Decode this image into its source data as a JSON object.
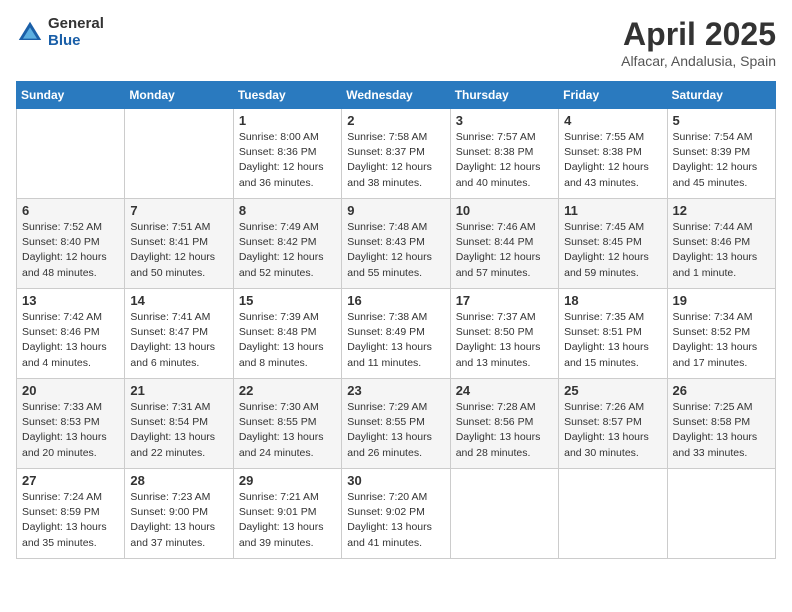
{
  "header": {
    "logo_general": "General",
    "logo_blue": "Blue",
    "month_title": "April 2025",
    "location": "Alfacar, Andalusia, Spain"
  },
  "weekdays": [
    "Sunday",
    "Monday",
    "Tuesday",
    "Wednesday",
    "Thursday",
    "Friday",
    "Saturday"
  ],
  "weeks": [
    [
      null,
      null,
      {
        "day": 1,
        "sunrise": "8:00 AM",
        "sunset": "8:36 PM",
        "daylight": "12 hours and 36 minutes."
      },
      {
        "day": 2,
        "sunrise": "7:58 AM",
        "sunset": "8:37 PM",
        "daylight": "12 hours and 38 minutes."
      },
      {
        "day": 3,
        "sunrise": "7:57 AM",
        "sunset": "8:38 PM",
        "daylight": "12 hours and 40 minutes."
      },
      {
        "day": 4,
        "sunrise": "7:55 AM",
        "sunset": "8:38 PM",
        "daylight": "12 hours and 43 minutes."
      },
      {
        "day": 5,
        "sunrise": "7:54 AM",
        "sunset": "8:39 PM",
        "daylight": "12 hours and 45 minutes."
      }
    ],
    [
      {
        "day": 6,
        "sunrise": "7:52 AM",
        "sunset": "8:40 PM",
        "daylight": "12 hours and 48 minutes."
      },
      {
        "day": 7,
        "sunrise": "7:51 AM",
        "sunset": "8:41 PM",
        "daylight": "12 hours and 50 minutes."
      },
      {
        "day": 8,
        "sunrise": "7:49 AM",
        "sunset": "8:42 PM",
        "daylight": "12 hours and 52 minutes."
      },
      {
        "day": 9,
        "sunrise": "7:48 AM",
        "sunset": "8:43 PM",
        "daylight": "12 hours and 55 minutes."
      },
      {
        "day": 10,
        "sunrise": "7:46 AM",
        "sunset": "8:44 PM",
        "daylight": "12 hours and 57 minutes."
      },
      {
        "day": 11,
        "sunrise": "7:45 AM",
        "sunset": "8:45 PM",
        "daylight": "12 hours and 59 minutes."
      },
      {
        "day": 12,
        "sunrise": "7:44 AM",
        "sunset": "8:46 PM",
        "daylight": "13 hours and 1 minute."
      }
    ],
    [
      {
        "day": 13,
        "sunrise": "7:42 AM",
        "sunset": "8:46 PM",
        "daylight": "13 hours and 4 minutes."
      },
      {
        "day": 14,
        "sunrise": "7:41 AM",
        "sunset": "8:47 PM",
        "daylight": "13 hours and 6 minutes."
      },
      {
        "day": 15,
        "sunrise": "7:39 AM",
        "sunset": "8:48 PM",
        "daylight": "13 hours and 8 minutes."
      },
      {
        "day": 16,
        "sunrise": "7:38 AM",
        "sunset": "8:49 PM",
        "daylight": "13 hours and 11 minutes."
      },
      {
        "day": 17,
        "sunrise": "7:37 AM",
        "sunset": "8:50 PM",
        "daylight": "13 hours and 13 minutes."
      },
      {
        "day": 18,
        "sunrise": "7:35 AM",
        "sunset": "8:51 PM",
        "daylight": "13 hours and 15 minutes."
      },
      {
        "day": 19,
        "sunrise": "7:34 AM",
        "sunset": "8:52 PM",
        "daylight": "13 hours and 17 minutes."
      }
    ],
    [
      {
        "day": 20,
        "sunrise": "7:33 AM",
        "sunset": "8:53 PM",
        "daylight": "13 hours and 20 minutes."
      },
      {
        "day": 21,
        "sunrise": "7:31 AM",
        "sunset": "8:54 PM",
        "daylight": "13 hours and 22 minutes."
      },
      {
        "day": 22,
        "sunrise": "7:30 AM",
        "sunset": "8:55 PM",
        "daylight": "13 hours and 24 minutes."
      },
      {
        "day": 23,
        "sunrise": "7:29 AM",
        "sunset": "8:55 PM",
        "daylight": "13 hours and 26 minutes."
      },
      {
        "day": 24,
        "sunrise": "7:28 AM",
        "sunset": "8:56 PM",
        "daylight": "13 hours and 28 minutes."
      },
      {
        "day": 25,
        "sunrise": "7:26 AM",
        "sunset": "8:57 PM",
        "daylight": "13 hours and 30 minutes."
      },
      {
        "day": 26,
        "sunrise": "7:25 AM",
        "sunset": "8:58 PM",
        "daylight": "13 hours and 33 minutes."
      }
    ],
    [
      {
        "day": 27,
        "sunrise": "7:24 AM",
        "sunset": "8:59 PM",
        "daylight": "13 hours and 35 minutes."
      },
      {
        "day": 28,
        "sunrise": "7:23 AM",
        "sunset": "9:00 PM",
        "daylight": "13 hours and 37 minutes."
      },
      {
        "day": 29,
        "sunrise": "7:21 AM",
        "sunset": "9:01 PM",
        "daylight": "13 hours and 39 minutes."
      },
      {
        "day": 30,
        "sunrise": "7:20 AM",
        "sunset": "9:02 PM",
        "daylight": "13 hours and 41 minutes."
      },
      null,
      null,
      null
    ]
  ]
}
